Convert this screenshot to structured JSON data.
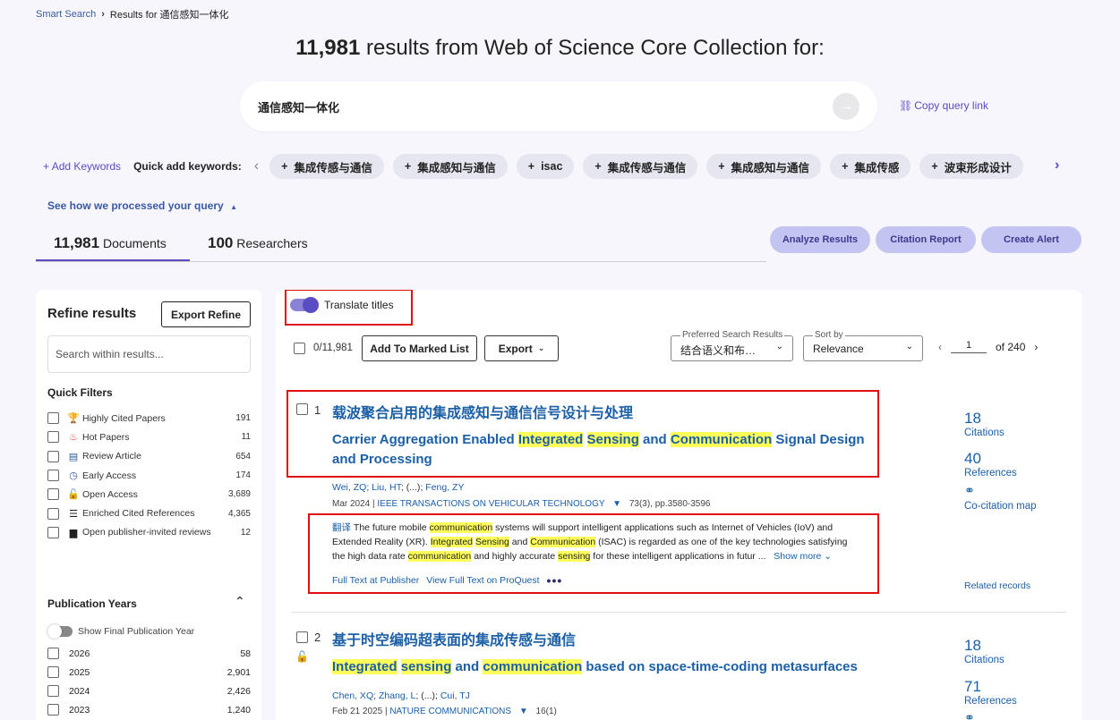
{
  "breadcrumb": {
    "root": "Smart Search",
    "current": "Results for 通信感知一体化"
  },
  "header": {
    "count": "11,981",
    "text": "results from Web of Science Core Collection for:"
  },
  "search": {
    "query": "通信感知一体化",
    "copy_link": "Copy query link"
  },
  "keywords": {
    "add_label": "Add Keywords",
    "quick_label": "Quick add keywords:",
    "chips": [
      "集成传感与通信",
      "集成感知与通信",
      "isac",
      "集成传感与通信",
      "集成感知与通信",
      "集成传感",
      "波束形成设计"
    ]
  },
  "processed_query": "See how we processed your query",
  "tabs": {
    "documents_count": "11,981",
    "documents_label": "Documents",
    "researchers_count": "100",
    "researchers_label": "Researchers"
  },
  "actions": {
    "analyze": "Analyze Results",
    "citation_report": "Citation Report",
    "create_alert": "Create Alert"
  },
  "refine": {
    "title": "Refine results",
    "export_button": "Export Refine",
    "search_placeholder": "Search within results...",
    "quick_filters_title": "Quick Filters",
    "quick_filters": [
      {
        "icon": "trophy-icon",
        "label": "Highly Cited Papers",
        "count": "191"
      },
      {
        "icon": "flame-icon",
        "label": "Hot Papers",
        "count": "11"
      },
      {
        "icon": "document-icon",
        "label": "Review Article",
        "count": "654"
      },
      {
        "icon": "clock-icon",
        "label": "Early Access",
        "count": "174"
      },
      {
        "icon": "lock-open-icon",
        "label": "Open Access",
        "count": "3,689"
      },
      {
        "icon": "enriched-list-icon",
        "label": "Enriched Cited References",
        "count": "4,365"
      },
      {
        "icon": "comment-icon",
        "label": "Open publisher-invited reviews",
        "count": "12"
      }
    ],
    "pub_years_title": "Publication Years",
    "show_final_label": "Show Final Publication Year",
    "years": [
      {
        "year": "2026",
        "count": "58"
      },
      {
        "year": "2025",
        "count": "2,901"
      },
      {
        "year": "2024",
        "count": "2,426"
      },
      {
        "year": "2023",
        "count": "1,240"
      }
    ]
  },
  "toolbar": {
    "translate_label": "Translate titles",
    "selected": "0/11,981",
    "add_marked": "Add To Marked List",
    "export": "Export",
    "pref_legend": "Preferred Search Results",
    "pref_value": "结合语义和布…",
    "sort_legend": "Sort by",
    "sort_value": "Relevance",
    "page": "1",
    "of_label": "of",
    "total_pages": "240"
  },
  "records": [
    {
      "num": "1",
      "title_cn": "载波聚合启用的集成感知与通信信号设计与处理",
      "authors": [
        "Wei, ZQ",
        "Liu, HT",
        "(...)",
        "Feng, ZY"
      ],
      "date": "Mar 2024",
      "journal": "IEEE TRANSACTIONS ON VEHICULAR TECHNOLOGY",
      "volume": "73(3), pp.3580-3596",
      "abstract_tag": "翻译",
      "show_more": "Show more",
      "link_publisher": "Full Text at Publisher",
      "link_proquest": "View Full Text on ProQuest",
      "citations": "18",
      "citations_label": "Citations",
      "references": "40",
      "references_label": "References",
      "cocitation": "Co-citation map",
      "related": "Related records"
    },
    {
      "num": "2",
      "title_cn": "基于时空编码超表面的集成传感与通信",
      "authors": [
        "Chen, XQ",
        "Zhang, L",
        "(...)",
        "Cui, TJ"
      ],
      "date": "Feb 21 2025",
      "journal": "NATURE COMMUNICATIONS",
      "volume": "16(1)",
      "citations": "18",
      "citations_label": "Citations",
      "references": "71",
      "references_label": "References"
    }
  ],
  "colors": {
    "accent": "#5a4dc4",
    "link": "#1b5fa6",
    "highlight": "#ffff5c",
    "annotation": "#e01010"
  }
}
